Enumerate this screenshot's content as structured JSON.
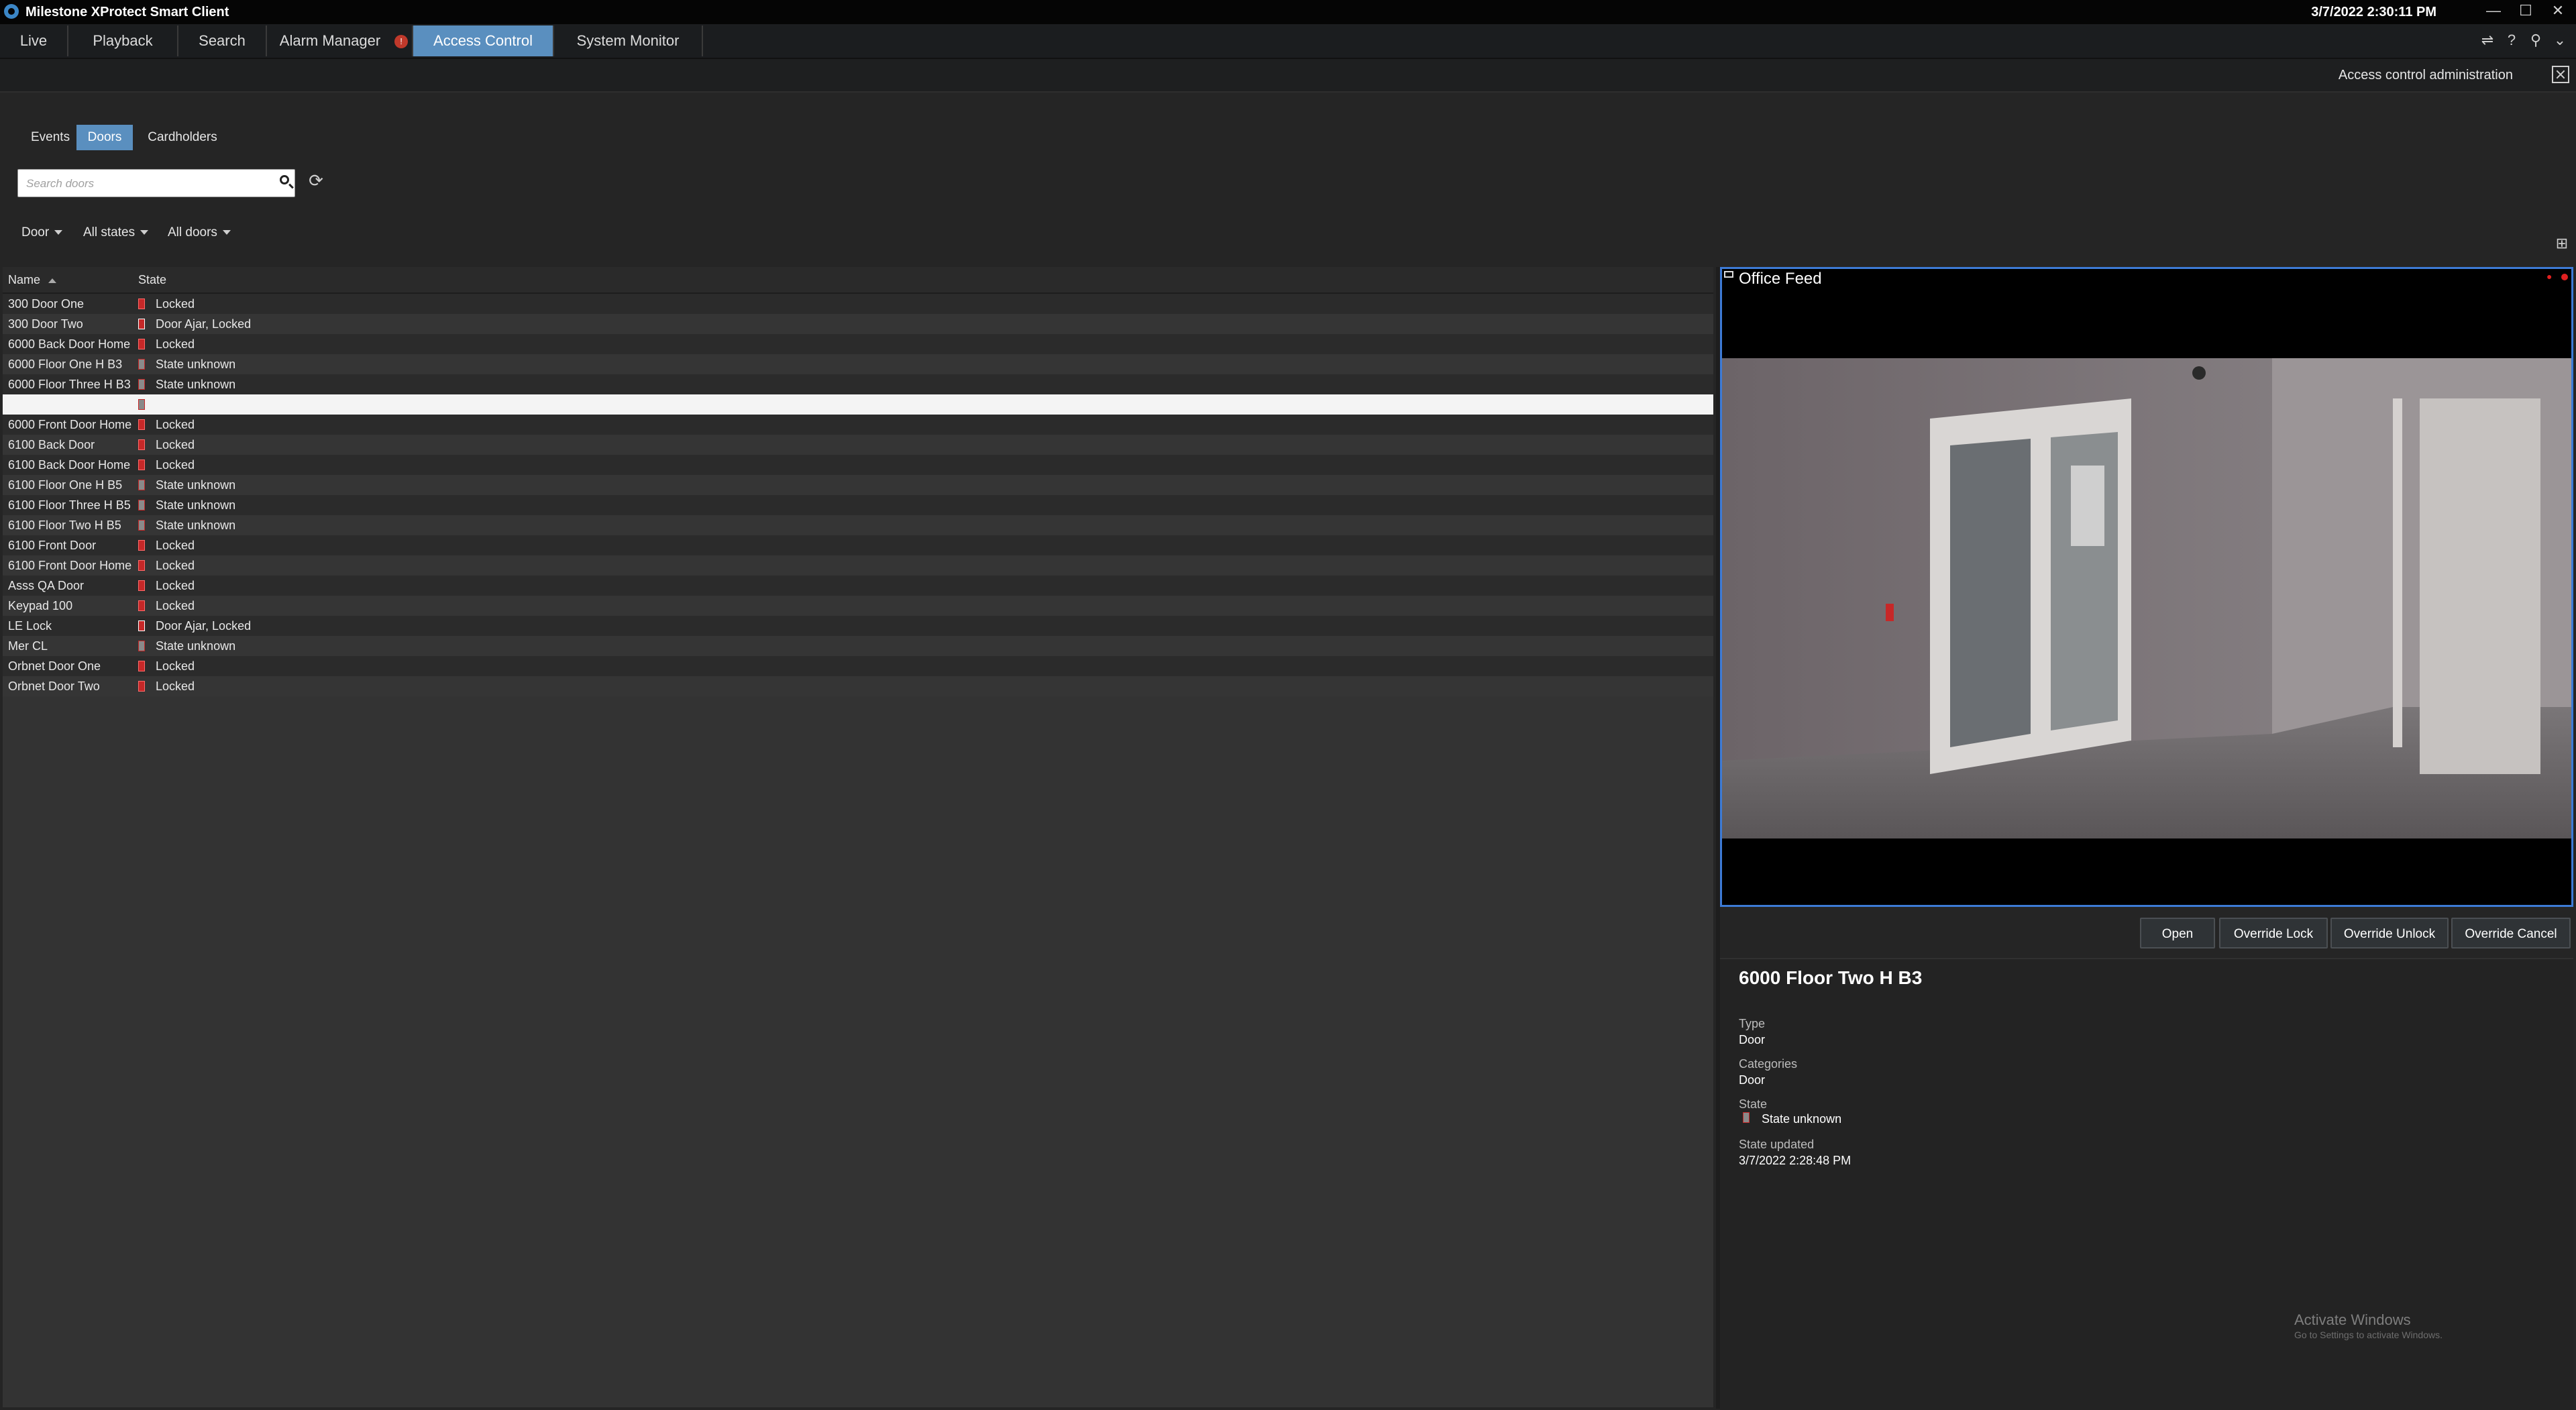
{
  "window": {
    "title": "Milestone XProtect Smart Client",
    "clock": "3/7/2022 2:30:11 PM",
    "controls": {
      "minimize": "—",
      "maximize": "☐",
      "close": "✕"
    }
  },
  "nav": {
    "tabs": [
      "Live",
      "Playback",
      "Search",
      "Alarm Manager",
      "Access Control",
      "System Monitor"
    ],
    "active_tab": "Access Control",
    "alarm_badge": "!",
    "tools": {
      "disconnect": "⇌",
      "help": "?",
      "pin": "⚲",
      "menu": "⌄"
    }
  },
  "subheader": {
    "title": "Access control administration"
  },
  "subtabs": {
    "items": [
      "Events",
      "Doors",
      "Cardholders"
    ],
    "active": "Doors"
  },
  "search": {
    "placeholder": "Search doors",
    "value": "",
    "refresh_glyph": "⟳"
  },
  "filters": {
    "type": "Door",
    "states": "All states",
    "doors": "All doors",
    "layout_glyph": "⊞"
  },
  "table": {
    "columns": {
      "name": "Name",
      "state": "State"
    },
    "sort": "Name ascending",
    "rows": [
      {
        "name": "300 Door One",
        "state": "Locked",
        "status": "locked"
      },
      {
        "name": "300 Door Two",
        "state": "Door Ajar, Locked",
        "status": "ajar"
      },
      {
        "name": "6000 Back Door Home",
        "state": "Locked",
        "status": "locked"
      },
      {
        "name": "6000 Floor One H B3",
        "state": "State unknown",
        "status": "unknown"
      },
      {
        "name": "6000 Floor Three H B3",
        "state": "State unknown",
        "status": "unknown"
      },
      {
        "name": "",
        "state": "",
        "status": "unknown",
        "selected": true
      },
      {
        "name": "6000 Front Door Home",
        "state": "Locked",
        "status": "locked"
      },
      {
        "name": "6100 Back Door",
        "state": "Locked",
        "status": "locked"
      },
      {
        "name": "6100 Back Door Home",
        "state": "Locked",
        "status": "locked"
      },
      {
        "name": "6100 Floor One H B5",
        "state": "State unknown",
        "status": "unknown"
      },
      {
        "name": "6100 Floor Three H B5",
        "state": "State unknown",
        "status": "unknown"
      },
      {
        "name": "6100 Floor Two H B5",
        "state": "State unknown",
        "status": "unknown"
      },
      {
        "name": "6100 Front Door",
        "state": "Locked",
        "status": "locked"
      },
      {
        "name": "6100 Front Door Home",
        "state": "Locked",
        "status": "locked"
      },
      {
        "name": "Asss QA Door",
        "state": "Locked",
        "status": "locked"
      },
      {
        "name": "Keypad 100",
        "state": "Locked",
        "status": "locked"
      },
      {
        "name": "LE Lock",
        "state": "Door Ajar, Locked",
        "status": "ajar"
      },
      {
        "name": "Mer CL",
        "state": "State unknown",
        "status": "unknown"
      },
      {
        "name": "Orbnet Door One",
        "state": "Locked",
        "status": "locked"
      },
      {
        "name": "Orbnet Door Two",
        "state": "Locked",
        "status": "locked"
      }
    ]
  },
  "video": {
    "title": "Office Feed"
  },
  "actions": {
    "open": "Open",
    "override_lock": "Override Lock",
    "override_unlock": "Override Unlock",
    "override_cancel": "Override Cancel"
  },
  "details": {
    "title": "6000 Floor Two H B3",
    "type_label": "Type",
    "type_value": "Door",
    "categories_label": "Categories",
    "categories_value": "Door",
    "state_label": "State",
    "state_value": "State unknown",
    "updated_label": "State updated",
    "updated_value": "3/7/2022 2:28:48 PM"
  },
  "watermark": {
    "line1": "Activate Windows",
    "line2": "Go to Settings to activate Windows."
  },
  "colors": {
    "accent": "#5a8fbf",
    "selection_border": "#3d7bd6",
    "locked": "#c62828",
    "unknown": "#8a8a8a"
  }
}
